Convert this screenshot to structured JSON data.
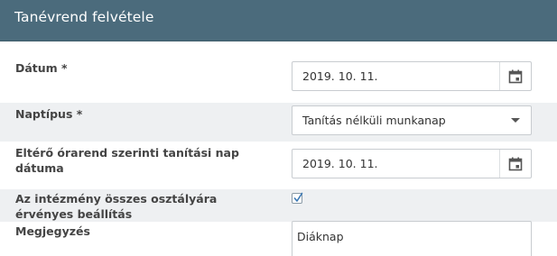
{
  "dialog": {
    "title": "Tanévrend felvétele"
  },
  "form": {
    "date": {
      "label": "Dátum *",
      "value": "2019. 10. 11."
    },
    "day_type": {
      "label": "Naptípus *",
      "value": "Tanítás nélküli munkanap"
    },
    "alt_schedule_date": {
      "label": "Eltérő órarend szerinti tanítási nap dátuma",
      "value": "2019. 10. 11."
    },
    "all_classes": {
      "label": "Az intézmény összes osztályára érvényes beállítás",
      "checked": true
    },
    "note": {
      "label": "Megjegyzés",
      "value": "Diáknap"
    }
  },
  "icons": {
    "calendar": "calendar-icon",
    "dropdown": "chevron-down-icon",
    "check": "check-icon"
  },
  "colors": {
    "header_bg": "#4b6b7c",
    "row_shade": "#eef0f2",
    "check_color": "#3a78b5"
  }
}
